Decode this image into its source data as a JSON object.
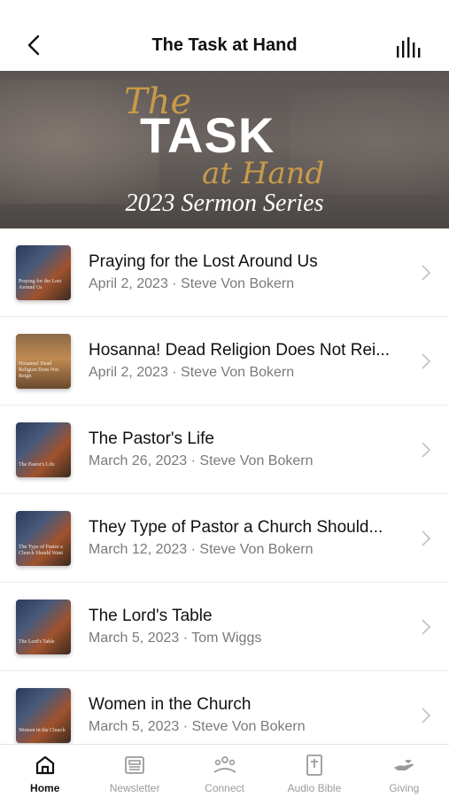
{
  "header": {
    "title": "The Task at Hand"
  },
  "banner": {
    "script_the": "The",
    "task": "TASK",
    "script_at_hand": "at Hand",
    "series": "2023 Sermon Series"
  },
  "sermons": [
    {
      "title": "Praying for the Lost Around Us",
      "subtitle": "April 2, 2023 · Steve Von Bokern",
      "thumb_caption": "Praying for the Lost Around Us"
    },
    {
      "title": "Hosanna! Dead Religion Does Not Rei...",
      "subtitle": "April 2, 2023 · Steve Von Bokern",
      "thumb_caption": "Hosanna! Dead Religion Does Not Reign"
    },
    {
      "title": "The Pastor's Life",
      "subtitle": "March 26, 2023 · Steve Von Bokern",
      "thumb_caption": "The Pastor's Life"
    },
    {
      "title": "They Type of Pastor a Church Should...",
      "subtitle": "March 12, 2023 · Steve Von Bokern",
      "thumb_caption": "The Type of Pastor a Church Should Want"
    },
    {
      "title": "The Lord's Table",
      "subtitle": "March 5, 2023 · Tom Wiggs",
      "thumb_caption": "The Lord's Table"
    },
    {
      "title": "Women in the Church",
      "subtitle": "March 5, 2023 · Steve Von Bokern",
      "thumb_caption": "Women in the Church"
    }
  ],
  "tabs": {
    "home": "Home",
    "newsletter": "Newsletter",
    "connect": "Connect",
    "audio_bible": "Audio Bible",
    "giving": "Giving"
  },
  "colors": {
    "accent_gold": "#c99a4a",
    "text_primary": "#111111",
    "text_secondary": "#7a7a7a",
    "tab_inactive": "#9a9a9a"
  }
}
